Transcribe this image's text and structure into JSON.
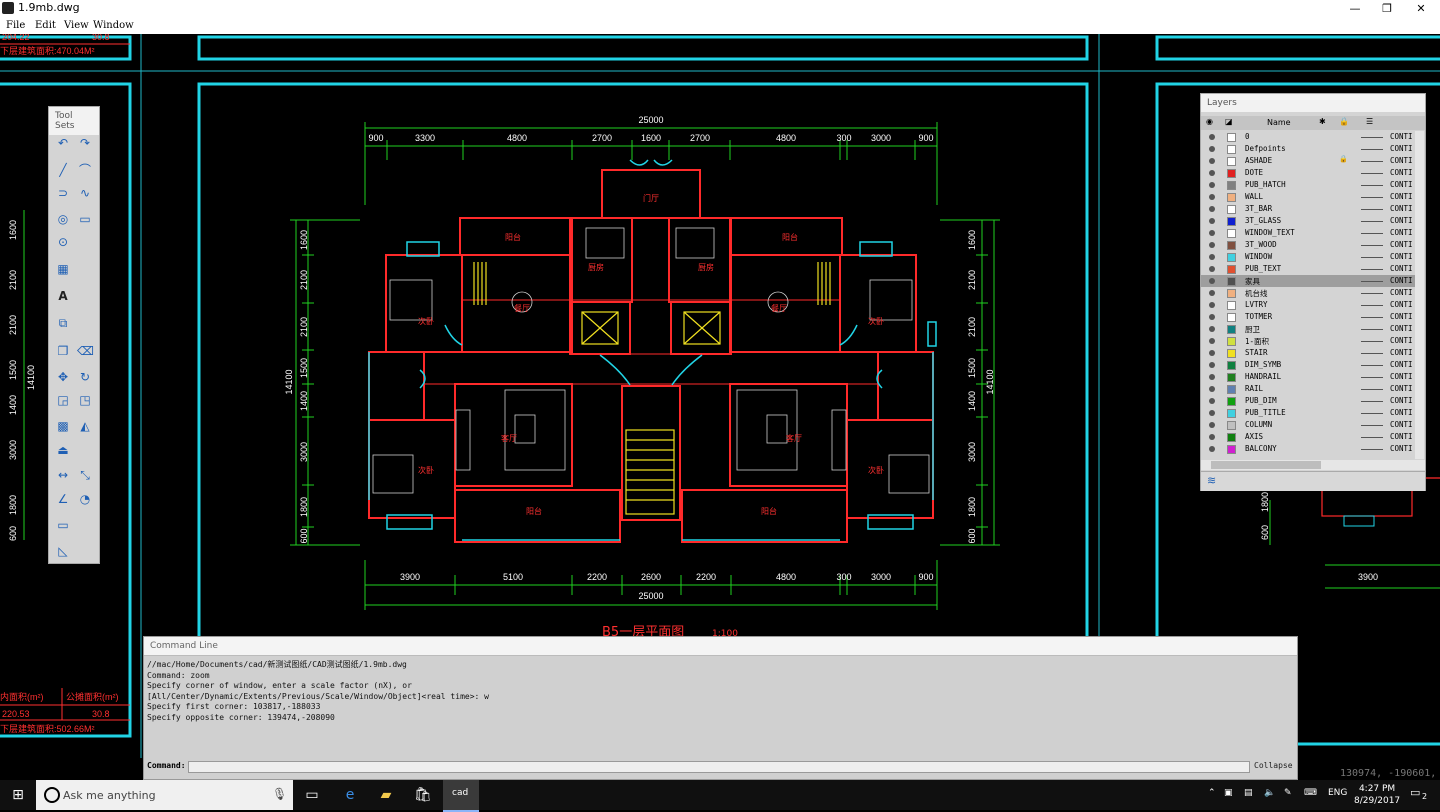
{
  "window": {
    "title": "1.9mb.dwg",
    "minimize": "—",
    "maximize": "❐",
    "close": "✕"
  },
  "menu": [
    "File",
    "Edit",
    "View",
    "Window"
  ],
  "drawing": {
    "dims_top_total": "25000",
    "dims_top": [
      "900",
      "3300",
      "4800",
      "2700",
      "1600",
      "2700",
      "4800",
      "300",
      "3000",
      "900"
    ],
    "dims_bottom": [
      "3900",
      "5100",
      "2200",
      "2600",
      "2200",
      "4800",
      "300",
      "3000",
      "900"
    ],
    "dims_bottom_total": "25000",
    "dims_left": [
      "1600",
      "2100",
      "2100",
      "1500",
      "1400",
      "3000",
      "1800",
      "600"
    ],
    "dims_right": [
      "1600",
      "2100",
      "2100",
      "1500",
      "1400",
      "3000",
      "1800",
      "600"
    ],
    "dims_side_total": "14100",
    "rooms": [
      "门厅",
      "阳台",
      "阳台",
      "厨房",
      "厨房",
      "餐厅",
      "餐厅",
      "次卧",
      "次卧",
      "客厅",
      "客厅",
      "次卧",
      "次卧",
      "阳台",
      "阳台"
    ],
    "plan_title": "B5一层平面图",
    "plan_scale": "1:100",
    "left_texts": {
      "t1": "204.22",
      "t2": "30.8",
      "t3": "下层建筑面积:470.04M²",
      "t4": "内面积(m²)",
      "t5": "公摊面积(m²)",
      "t6": "220.53",
      "t7": "30.8",
      "t8": "下层建筑面积:502.66M²"
    },
    "right_partial_dims": [
      "1800",
      "600",
      "3900"
    ]
  },
  "toolsets": {
    "title": "Tool Sets"
  },
  "layers": {
    "title": "Layers",
    "header_name": "Name",
    "rows": [
      {
        "name": "0",
        "color": "#ffffff",
        "lt": "CONTI"
      },
      {
        "name": "Defpoints",
        "color": "#ffffff",
        "lt": "CONTI"
      },
      {
        "name": "ASHADE",
        "color": "#ffffff",
        "lt": "CONTI",
        "locked": true
      },
      {
        "name": "DOTE",
        "color": "#e02020",
        "lt": "CONTI"
      },
      {
        "name": "PUB_HATCH",
        "color": "#808080",
        "lt": "CONTI"
      },
      {
        "name": "WALL",
        "color": "#f0b080",
        "lt": "CONTI"
      },
      {
        "name": "3T_BAR",
        "color": "#ffffff",
        "lt": "CONTI"
      },
      {
        "name": "3T_GLASS",
        "color": "#1020d0",
        "lt": "CONTI"
      },
      {
        "name": "WINDOW_TEXT",
        "color": "#ffffff",
        "lt": "CONTI"
      },
      {
        "name": "3T_WOOD",
        "color": "#805040",
        "lt": "CONTI"
      },
      {
        "name": "WINDOW",
        "color": "#40d0e0",
        "lt": "CONTI"
      },
      {
        "name": "PUB_TEXT",
        "color": "#e05030",
        "lt": "CONTI"
      },
      {
        "name": "家具",
        "color": "#505050",
        "lt": "CONTI",
        "selected": true
      },
      {
        "name": "机台线",
        "color": "#f0b080",
        "lt": "CONTI"
      },
      {
        "name": "LVTRY",
        "color": "#ffffff",
        "lt": "CONTI"
      },
      {
        "name": "TOTMER",
        "color": "#ffffff",
        "lt": "CONTI"
      },
      {
        "name": "厨卫",
        "color": "#108080",
        "lt": "CONTI"
      },
      {
        "name": "1-面积",
        "color": "#d0e040",
        "lt": "CONTI"
      },
      {
        "name": "STAIR",
        "color": "#f0e020",
        "lt": "CONTI"
      },
      {
        "name": "DIM_SYMB",
        "color": "#108040",
        "lt": "CONTI"
      },
      {
        "name": "HANDRAIL",
        "color": "#208020",
        "lt": "CONTI"
      },
      {
        "name": "RAIL",
        "color": "#6080b0",
        "lt": "CONTI"
      },
      {
        "name": "PUB_DIM",
        "color": "#10a010",
        "lt": "CONTI"
      },
      {
        "name": "PUB_TITLE",
        "color": "#40d0e0",
        "lt": "CONTI"
      },
      {
        "name": "COLUMN",
        "color": "#c0c0c0",
        "lt": "CONTI"
      },
      {
        "name": "AXIS",
        "color": "#108010",
        "lt": "CONTI"
      },
      {
        "name": "BALCONY",
        "color": "#d020d0",
        "lt": "CONTI"
      }
    ]
  },
  "command": {
    "title": "Command Line",
    "lines": [
      "//mac/Home/Documents/cad/新测试图纸/CAD测试图纸/1.9mb.dwg",
      "Command: zoom",
      "Specify corner of window, enter a scale factor (nX), or",
      "[All/Center/Dynamic/Extents/Previous/Scale/Window/Object]<real time>: w",
      "Specify first corner: 103817,-188033",
      "Specify opposite corner: 139474,-208090"
    ],
    "prompt": "Command:",
    "collapse": "Collapse"
  },
  "coords": "130974, -190601, 0",
  "taskbar": {
    "search_placeholder": "Ask me anything",
    "lang": "ENG",
    "time": "4:27 PM",
    "date": "8/29/2017",
    "notifications": "2"
  }
}
